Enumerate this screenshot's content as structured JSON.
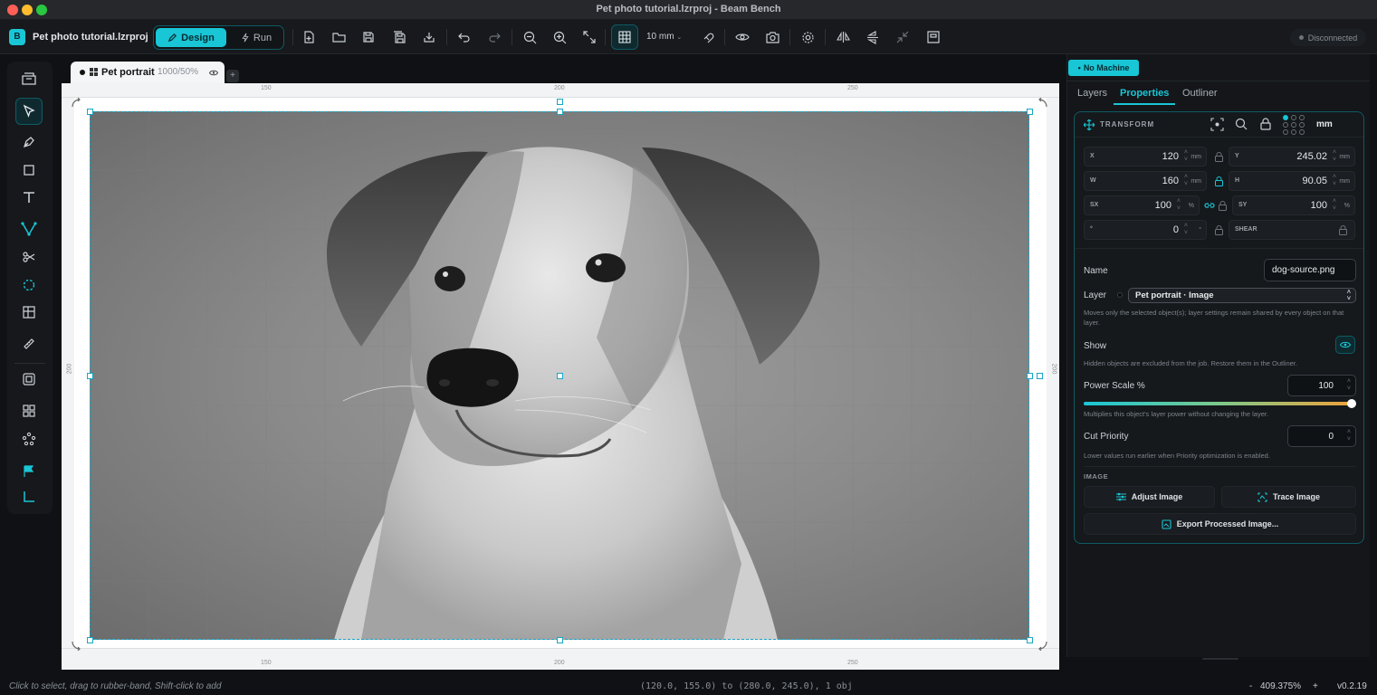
{
  "window": {
    "title": "Pet photo tutorial.lzrproj - Beam Bench"
  },
  "toolbar": {
    "project_name": "Pet photo tutorial.lzrproj",
    "design_label": "Design",
    "run_label": "Run",
    "grid_size": "10 mm",
    "connection_status": "Disconnected",
    "app_badge": "B"
  },
  "document": {
    "tab_name": "Pet portrait",
    "tab_zoom": "1000/50%",
    "add_tab": "+"
  },
  "rulers": {
    "top": [
      "150",
      "200",
      "250"
    ],
    "bottom": [
      "150",
      "200",
      "250"
    ],
    "left": "200",
    "right": "200"
  },
  "right_panel": {
    "machine_label": "No Machine",
    "tabs": [
      "Layers",
      "Properties",
      "Outliner"
    ],
    "active_tab": "Properties",
    "transform": {
      "header": "TRANSFORM",
      "unit": "mm",
      "x_label": "X",
      "x": "120",
      "x_unit": "mm",
      "y_label": "Y",
      "y": "245.02",
      "y_unit": "mm",
      "w_label": "W",
      "w": "160",
      "w_unit": "mm",
      "h_label": "H",
      "h": "90.05",
      "h_unit": "mm",
      "sx_label": "SX",
      "sx": "100",
      "sx_unit": "%",
      "sy_label": "SY",
      "sy": "100",
      "sy_unit": "%",
      "rot_label": "°",
      "rot": "0",
      "rot_unit": "°",
      "shear_label": "SHEAR"
    },
    "name_label": "Name",
    "name_value": "dog-source.png",
    "layer_label": "Layer",
    "layer_value": "Pet portrait · Image",
    "layer_help": "Moves only the selected object(s); layer settings remain shared by every object on that layer.",
    "show_label": "Show",
    "show_help": "Hidden objects are excluded from the job. Restore them in the Outliner.",
    "power_label": "Power Scale %",
    "power_value": "100",
    "power_fraction": 1.0,
    "power_help": "Multiplies this object's layer power without changing the layer.",
    "cut_label": "Cut Priority",
    "cut_value": "0",
    "cut_help": "Lower values run earlier when Priority optimization is enabled.",
    "image_section": "IMAGE",
    "adjust_label": "Adjust Image",
    "trace_label": "Trace Image",
    "export_label": "Export Processed Image..."
  },
  "status": {
    "hint": "Click to select, drag to rubber-band, Shift-click to add",
    "selection": "(120.0, 155.0) to (280.0, 245.0), 1 obj",
    "zoom": "409.375%",
    "zoom_minus": "-",
    "zoom_plus": "+",
    "version": "v0.2.19"
  },
  "colors": {
    "accent": "#19c6d6",
    "selection": "#1aa6c4"
  }
}
